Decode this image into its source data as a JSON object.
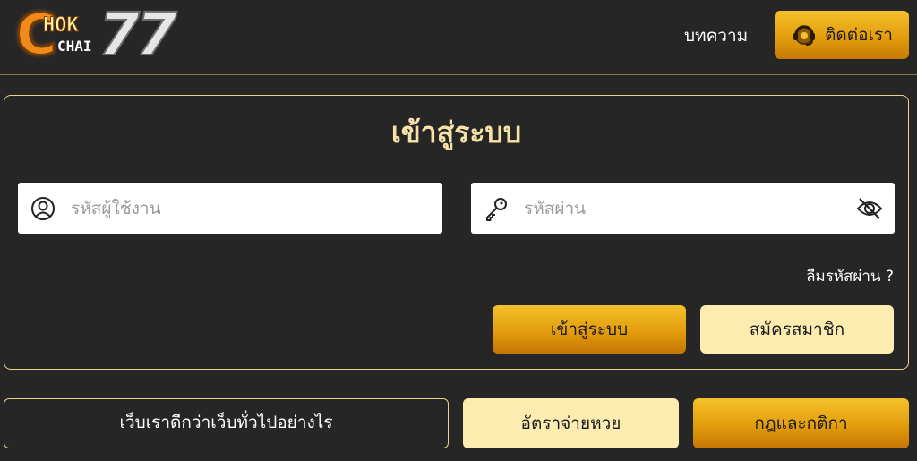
{
  "header": {
    "logo": {
      "g": "C",
      "hok": "HOK",
      "chai": "CHAI",
      "num": "77"
    },
    "nav_articles": "บทความ",
    "contact_label": "ติดต่อเรา",
    "contact_icon": "headset-icon"
  },
  "login": {
    "title": "เข้าสู่ระบบ",
    "username_placeholder": "รหัสผู้ใช้งาน",
    "username_value": "",
    "username_icon": "user-circle-icon",
    "password_placeholder": "รหัสผ่าน",
    "password_value": "",
    "password_icon": "key-icon",
    "toggle_icon": "eye-off-icon",
    "forgot_label": "ลืมรหัสผ่าน ?",
    "login_button": "เข้าสู่ระบบ",
    "register_button": "สมัครสมาชิก"
  },
  "footer_buttons": {
    "why": "เว็บเราดีกว่าเว็บทั่วไปอย่างไร",
    "rates": "อัตราจ่ายหวย",
    "rules": "กฎและกติกา"
  },
  "colors": {
    "background": "#262626",
    "gold": "#e39d0c",
    "cream": "#fcecb0",
    "title": "#f6e2a6",
    "border": "#e8d28a"
  }
}
